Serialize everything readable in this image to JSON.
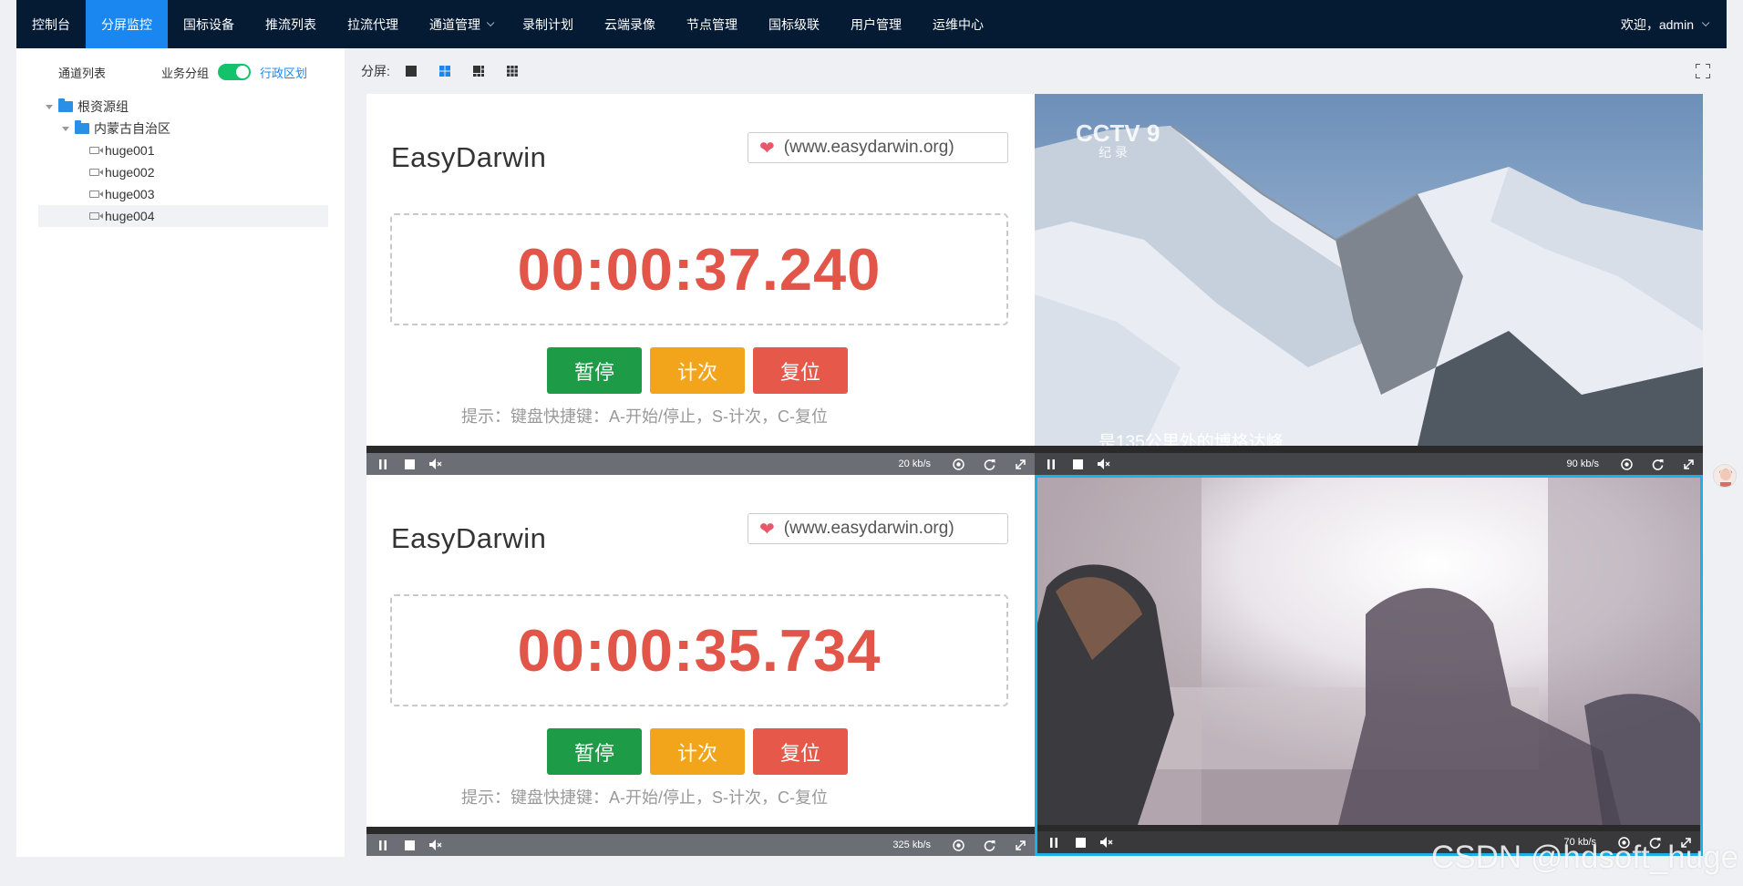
{
  "nav": {
    "items": [
      {
        "label": "控制台"
      },
      {
        "label": "分屏监控"
      },
      {
        "label": "国标设备"
      },
      {
        "label": "推流列表"
      },
      {
        "label": "拉流代理"
      },
      {
        "label": "通道管理"
      },
      {
        "label": "录制计划"
      },
      {
        "label": "云端录像"
      },
      {
        "label": "节点管理"
      },
      {
        "label": "国标级联"
      },
      {
        "label": "用户管理"
      },
      {
        "label": "运维中心"
      }
    ],
    "active": "分屏监控",
    "user": "欢迎，admin"
  },
  "sidebar": {
    "title": "通道列表",
    "toggle_left": "业务分组",
    "toggle_right": "行政区划",
    "tree": {
      "root": "根资源组",
      "region": "内蒙古自治区",
      "channels": [
        "huge001",
        "huge002",
        "huge003",
        "huge004"
      ],
      "selected": "huge004"
    }
  },
  "toolbar": {
    "split_label": "分屏:",
    "layouts": [
      "1",
      "4",
      "6",
      "9"
    ],
    "active_layout": "4"
  },
  "players": [
    {
      "url_text": "(www.easydarwin.org)",
      "logo": "EasyDarwin",
      "timer": "00:00:37.240",
      "buttons": [
        "暂停",
        "计次",
        "复位"
      ],
      "tip": "提示：键盘快捷键：A-开始/停止，S-计次，C-复位",
      "rate": "20 kb/s"
    },
    {
      "subtitle": "是135公里外的博格达峰",
      "channel_logo": "CCTV 9",
      "channel_sub": "纪 录",
      "rate": "90 kb/s"
    },
    {
      "url_text": "(www.easydarwin.org)",
      "logo": "EasyDarwin",
      "timer": "00:00:35.734",
      "buttons": [
        "暂停",
        "计次",
        "复位"
      ],
      "tip": "提示：键盘快捷键：A-开始/停止，S-计次，C-复位",
      "rate": "325 kb/s"
    },
    {
      "rate": "70 kb/s"
    }
  ],
  "watermark": "CSDN @hdsoft_huge",
  "colors": {
    "nav_bg": "#051a33",
    "nav_active": "#1a86f0",
    "timer": "#e2564a",
    "selected_border": "#1ab1e8"
  }
}
